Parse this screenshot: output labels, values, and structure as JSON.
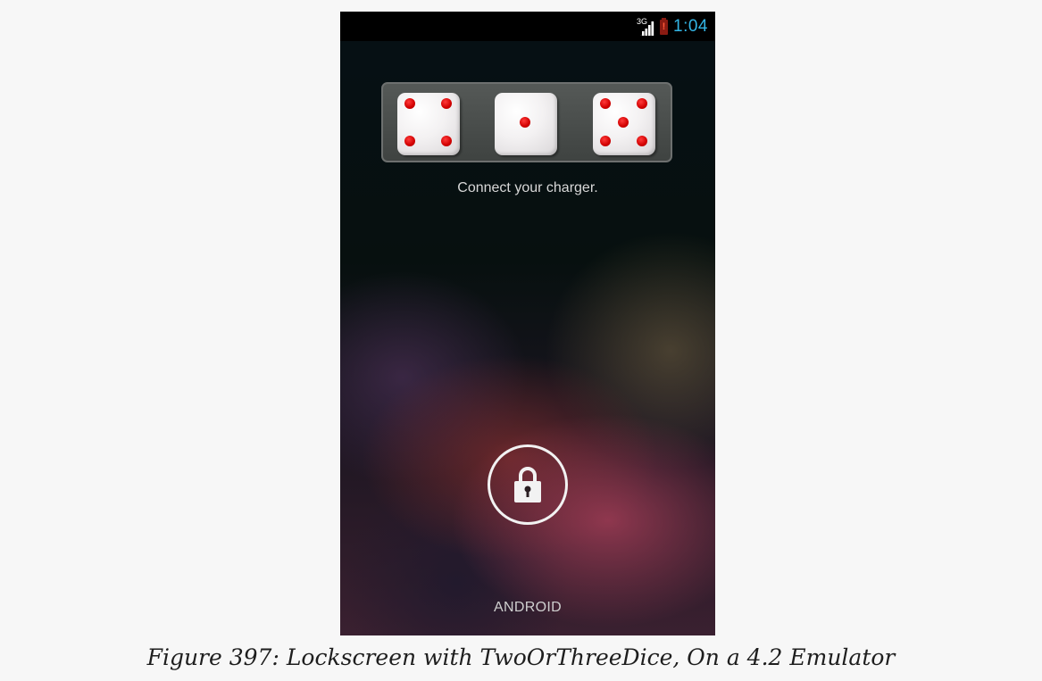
{
  "status_bar": {
    "network_type": "3G",
    "battery_alert": "!",
    "time": "1:04",
    "signal_icon": "signal-bars-icon",
    "battery_icon": "battery-low-icon",
    "time_color": "#33b5e5"
  },
  "dice": {
    "values": [
      4,
      1,
      5
    ],
    "pip_color": "#d10000"
  },
  "lockscreen": {
    "message": "Connect your charger.",
    "unlock_icon": "lock-icon",
    "carrier": "ANDROID"
  },
  "caption": "Figure 397: Lockscreen with TwoOrThreeDice, On a 4.2 Emulator"
}
